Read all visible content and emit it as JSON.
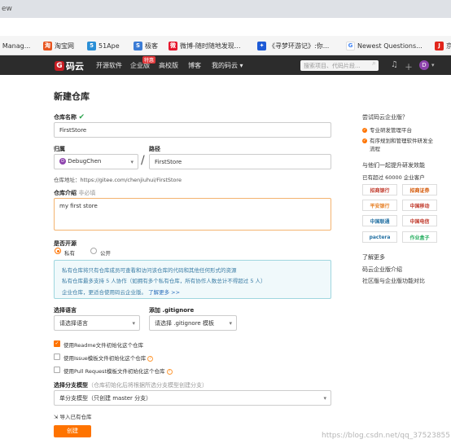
{
  "browser": {
    "tab_text": "ew",
    "bookmarks": [
      {
        "icon": "qq-icon",
        "label": "Q Manag..."
      },
      {
        "icon": "taobao-icon",
        "label": "淘宝网"
      },
      {
        "icon": "51ape-icon",
        "label": "51Ape"
      },
      {
        "icon": "jike-icon",
        "label": "极客"
      },
      {
        "icon": "weibo-icon",
        "label": "微博-随时随地发现..."
      },
      {
        "icon": "game-icon",
        "label": "《寻梦环游记》:你..."
      },
      {
        "icon": "google-icon",
        "label": "Newest Questions..."
      },
      {
        "icon": "jd-icon",
        "label": "京"
      }
    ]
  },
  "nav": {
    "logo": "码云",
    "links": [
      "开源软件",
      "企业版",
      "高校版",
      "博客",
      "我的码云"
    ],
    "badge": "特惠",
    "search_placeholder": "搜索项目、代码片段...",
    "avatar": "D"
  },
  "form": {
    "title": "新建仓库",
    "repo_name_label": "仓库名称",
    "repo_name_value": "FirstStore",
    "owner_label": "归属",
    "owner_value": "DebugChen",
    "owner_avatar": "D",
    "path_label": "路径",
    "path_value": "FirstStore",
    "repo_address": "仓库地址：https://gitee.com/chenjiuhui/FirstStore",
    "desc_label": "仓库介绍",
    "desc_optional": "非必填",
    "desc_value": "my first store",
    "visibility_label": "是否开源",
    "private_label": "私有",
    "public_label": "公开",
    "info_line1": "私有仓库将只有仓库成员可查看和访问该仓库的代码和其他任何形式的资源",
    "info_line2": "私有仓库最多支持 5 人协作（如拥有多个私有仓库，所有协作人数总计不得超过 5 人）",
    "info_line3": "企业仓库，更适合使用码云企业版。",
    "info_link": "了解更多 >>",
    "language_label": "选择语言",
    "language_value": "请选择语言",
    "gitignore_label": "添加 .gitignore",
    "gitignore_value": "请选择 .gitignore 模板",
    "readme_label": "使用Readme文件初始化这个仓库",
    "issue_label": "使用Issue模板文件初始化这个仓库",
    "pr_label": "使用Pull Request模板文件初始化这个仓库",
    "branch_label": "选择分支模型",
    "branch_hint": "（仓库初始化后将根据所选分支模型创建分支）",
    "branch_value": "单分支模型（只创建 master 分支）",
    "import_label": "导入已有仓库",
    "create_button": "创建"
  },
  "sidebar": {
    "try_title": "尝试码云企业版？",
    "bullets": [
      "专业研发管理平台",
      "有序规划和管理软件研发全",
      "流程"
    ],
    "together_title": "与他们一起提升研发效能",
    "customers": "已有超过 60000 企业客户",
    "logos": [
      "招商银行",
      "招商证券",
      "平安银行",
      "中国移动",
      "中国联通",
      "中国电信",
      "pactera",
      "作业盒子"
    ],
    "learn_title": "了解更多",
    "links": [
      "码云企业版介绍",
      "社区版与企业版功能对比"
    ]
  },
  "watermark": "https://blog.csdn.net/qq_37523855",
  "colors": {
    "accent": "#fe7300",
    "nav_bg": "#2c2c2c",
    "check": "#2da44e"
  }
}
